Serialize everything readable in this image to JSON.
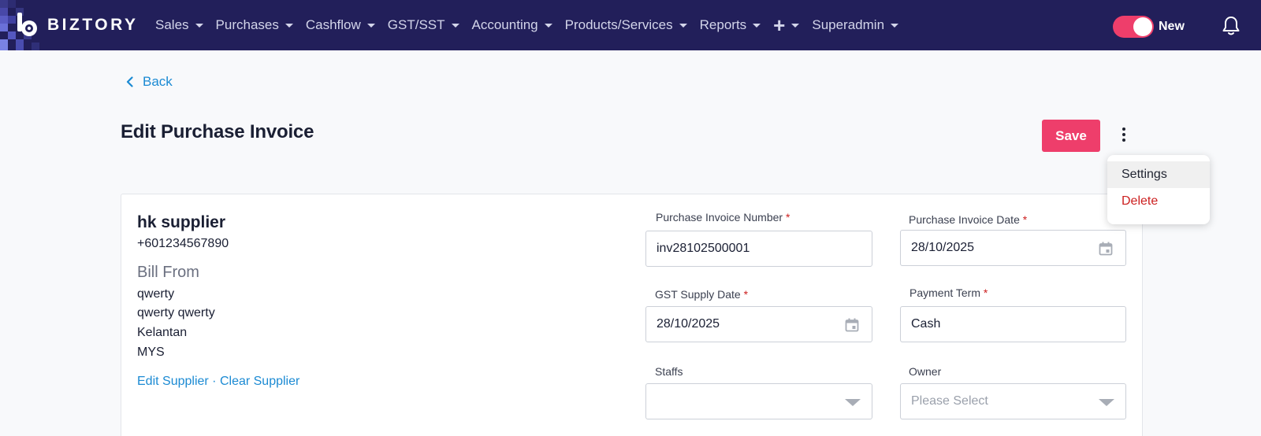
{
  "app": {
    "logo_text": "BIZTORY"
  },
  "nav": {
    "items": [
      {
        "label": "Sales"
      },
      {
        "label": "Purchases"
      },
      {
        "label": "Cashflow"
      },
      {
        "label": "GST/SST"
      },
      {
        "label": "Accounting"
      },
      {
        "label": "Products/Services"
      },
      {
        "label": "Reports"
      }
    ],
    "plus_symbol": "+",
    "user_label": "Superadmin",
    "toggle_label": "New"
  },
  "page": {
    "back_label": "Back",
    "title": "Edit Purchase Invoice",
    "save_label": "Save"
  },
  "menu": {
    "items": [
      {
        "label": "Settings"
      },
      {
        "label": "Delete"
      }
    ]
  },
  "supplier": {
    "name": "hk supplier",
    "phone": "+601234567890",
    "bill_from_label": "Bill From",
    "address": [
      "qwerty",
      "qwerty qwerty",
      "Kelantan",
      "MYS"
    ],
    "edit_label": "Edit Supplier",
    "separator": "·",
    "clear_label": "Clear Supplier"
  },
  "form": {
    "required_mark": "*",
    "invoice_number": {
      "label": "Purchase Invoice Number",
      "value": "inv28102500001"
    },
    "invoice_date": {
      "label": "Purchase Invoice Date",
      "value": "28/10/2025"
    },
    "gst_supply_date": {
      "label": "GST Supply Date",
      "value": "28/10/2025"
    },
    "payment_term": {
      "label": "Payment Term",
      "value": "Cash"
    },
    "staffs": {
      "label": "Staffs",
      "value": ""
    },
    "owner": {
      "label": "Owner",
      "placeholder": "Please Select"
    }
  },
  "colors": {
    "navbar": "#221f5a",
    "accent": "#ee3e6b",
    "link": "#1b8ad3",
    "danger": "#cc1f1f"
  },
  "icons": {
    "back": "chevron-left-icon",
    "caret": "caret-down-icon",
    "bell": "bell-icon",
    "calendar": "calendar-icon",
    "kebab": "kebab-menu-icon"
  }
}
